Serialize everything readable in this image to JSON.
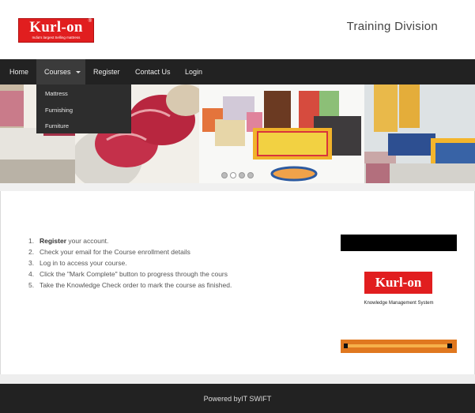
{
  "header": {
    "logo_word": "Kurl-on",
    "logo_tagline": "India's largest Selling mattress",
    "division": "Training Division"
  },
  "nav": {
    "items": [
      {
        "label": "Home"
      },
      {
        "label": "Courses"
      },
      {
        "label": "Register"
      },
      {
        "label": "Contact Us"
      },
      {
        "label": "Login"
      }
    ]
  },
  "dropdown": {
    "items": [
      {
        "label": "Mattress"
      },
      {
        "label": "Furnishing"
      },
      {
        "label": "Furniture"
      }
    ]
  },
  "slider": {
    "prev_icon": "chevron-left-icon",
    "next_icon": "chevron-right-icon",
    "dot_count": 4,
    "active_dot": 2
  },
  "steps": [
    {
      "num": "1.",
      "bold": "Register",
      "text": " your account."
    },
    {
      "num": "2.",
      "bold": "",
      "text": "Check your email for the Course enrollment details"
    },
    {
      "num": "3.",
      "bold": "",
      "text": "Log in to access your course."
    },
    {
      "num": "4.",
      "bold": "",
      "text": "Click the \"Mark Complete\" button to progress through the cours"
    },
    {
      "num": "5.",
      "bold": "",
      "text": "Take the Knowledge Check order to mark the course as finished."
    }
  ],
  "ad": {
    "logo_word": "Kurl-on",
    "caption": "Knowledge Management System"
  },
  "footer": {
    "text": "Powered byIT SWIFT"
  },
  "colors": {
    "brand_red": "#e11e1f",
    "nav_bg": "#222222",
    "ad_orange": "#e0781f"
  }
}
